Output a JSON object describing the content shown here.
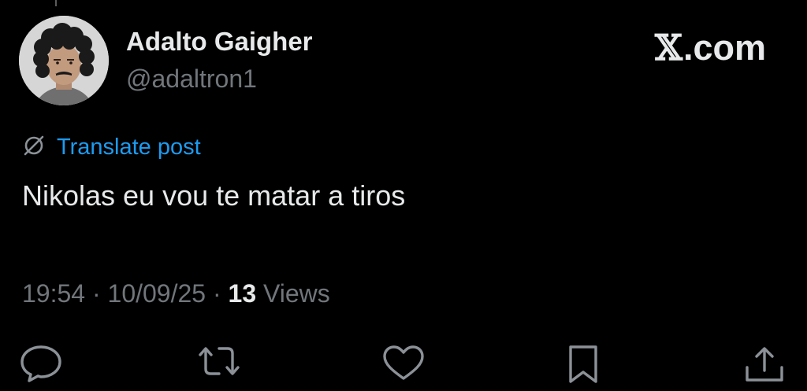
{
  "author": {
    "display_name": "Adalto Gaigher",
    "handle": "@adaltron1"
  },
  "brand": {
    "text": ".com",
    "logo_glyph": "𝕏"
  },
  "translate": {
    "label": "Translate post",
    "icon": "globe-strike-icon"
  },
  "post": {
    "text": "Nikolas eu vou te matar a tiros"
  },
  "meta": {
    "time": "19:54",
    "separator": "·",
    "date": "10/09/25",
    "views_count": "13",
    "views_label": "Views"
  },
  "actions": [
    {
      "name": "reply",
      "icon": "reply-icon"
    },
    {
      "name": "repost",
      "icon": "repost-icon"
    },
    {
      "name": "like",
      "icon": "heart-icon"
    },
    {
      "name": "bookmark",
      "icon": "bookmark-icon"
    },
    {
      "name": "share",
      "icon": "share-icon"
    }
  ],
  "colors": {
    "background": "#000000",
    "primary_text": "#e7e9ea",
    "secondary_text": "#71767b",
    "link": "#1d9bf0"
  }
}
